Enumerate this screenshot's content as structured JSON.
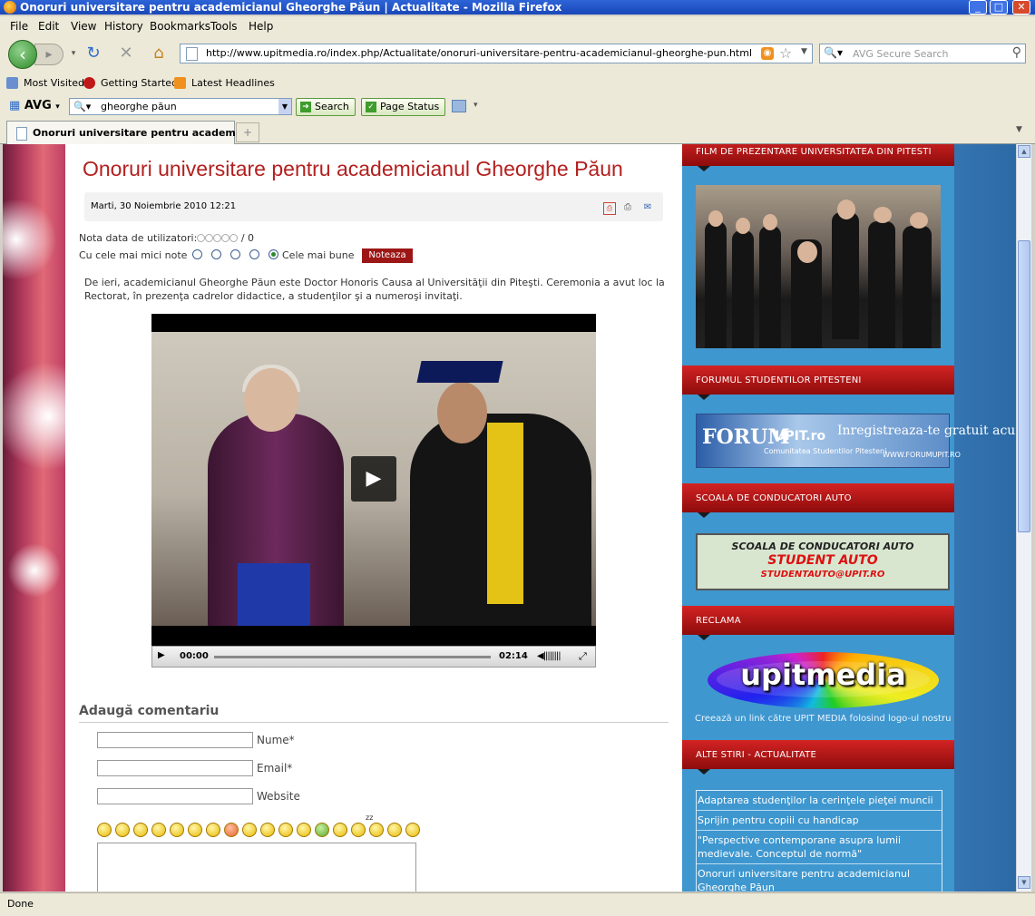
{
  "window": {
    "title": "Onoruri universitare pentru academicianul Gheorghe Păun | Actualitate - Mozilla Firefox"
  },
  "menu": [
    "File",
    "Edit",
    "View",
    "History",
    "Bookmarks",
    "Tools",
    "Help"
  ],
  "address": {
    "url": "http://www.upitmedia.ro/index.php/Actualitate/onoruri-universitare-pentru-academicianul-gheorghe-pun.html"
  },
  "search": {
    "placeholder": "AVG Secure Search"
  },
  "bookmarks": [
    "Most Visited",
    "Getting Started",
    "Latest Headlines"
  ],
  "avg": {
    "logo": "AVG",
    "query": "gheorghe păun",
    "search_label": "Search",
    "page_status_label": "Page Status"
  },
  "tab": {
    "title": "Onoruri universitare pentru academi..."
  },
  "article": {
    "title": "Onoruri universitare pentru academicianul Gheorghe Păun",
    "date": "Marti, 30 Noiembrie 2010 12:21",
    "rating_label": "Nota data de utilizatori:",
    "rating_value": "/ 0",
    "rating_low": "Cu cele mai mici note",
    "rating_high": "Cele mai bune",
    "rate_button": "Noteaza",
    "intro": "De ieri, academicianul Gheorghe Păun este Doctor Honoris Causa al Universităţii din Piteşti. Ceremonia a avut loc la Rectorat, în prezenţa cadrelor didactice, a studenţilor şi a numeroşi invitaţi."
  },
  "video": {
    "time_current": "00:00",
    "time_total": "02:14",
    "progress": 0
  },
  "comments": {
    "heading": "Adaugă comentariu",
    "name_label": "Nume*",
    "email_label": "Email*",
    "website_label": "Website",
    "zz": "zz"
  },
  "sidebar": {
    "film_heading": "FILM DE PREZENTARE UNIVERSITATEA DIN PITESTI",
    "forum_heading": "FORUMUL STUDENTILOR PITESTENI",
    "forum_banner": {
      "forum": "FORUM",
      "upit": "UPIT.ro",
      "sub": "Comunitatea Studentilor Pitesteni",
      "cta": "Inregistreaza-te gratuit acum!",
      "site": "WWW.FORUMUPIT.RO"
    },
    "scoala_heading": "SCOALA DE CONDUCATORI AUTO",
    "scoala_banner": {
      "line1": "SCOALA DE CONDUCATORI AUTO",
      "line2": "STUDENT AUTO",
      "line3": "STUDENTAUTO@UPIT.RO"
    },
    "reclama_heading": "RECLAMA",
    "upit_logo": "upitmedia",
    "upit_link": "Creează un link către UPIT MEDIA folosind logo-ul nostru",
    "news_heading": "ALTE STIRI - ACTUALITATE",
    "news": [
      "Adaptarea studenţilor la cerinţele pieţei muncii",
      "Sprijin pentru copiii cu handicap",
      "\"Perspective contemporane asupra lumii medievale. Conceptul de normă\"",
      "Onoruri universitare pentru academicianul Gheorghe Păun"
    ]
  },
  "status": {
    "text": "Done"
  }
}
